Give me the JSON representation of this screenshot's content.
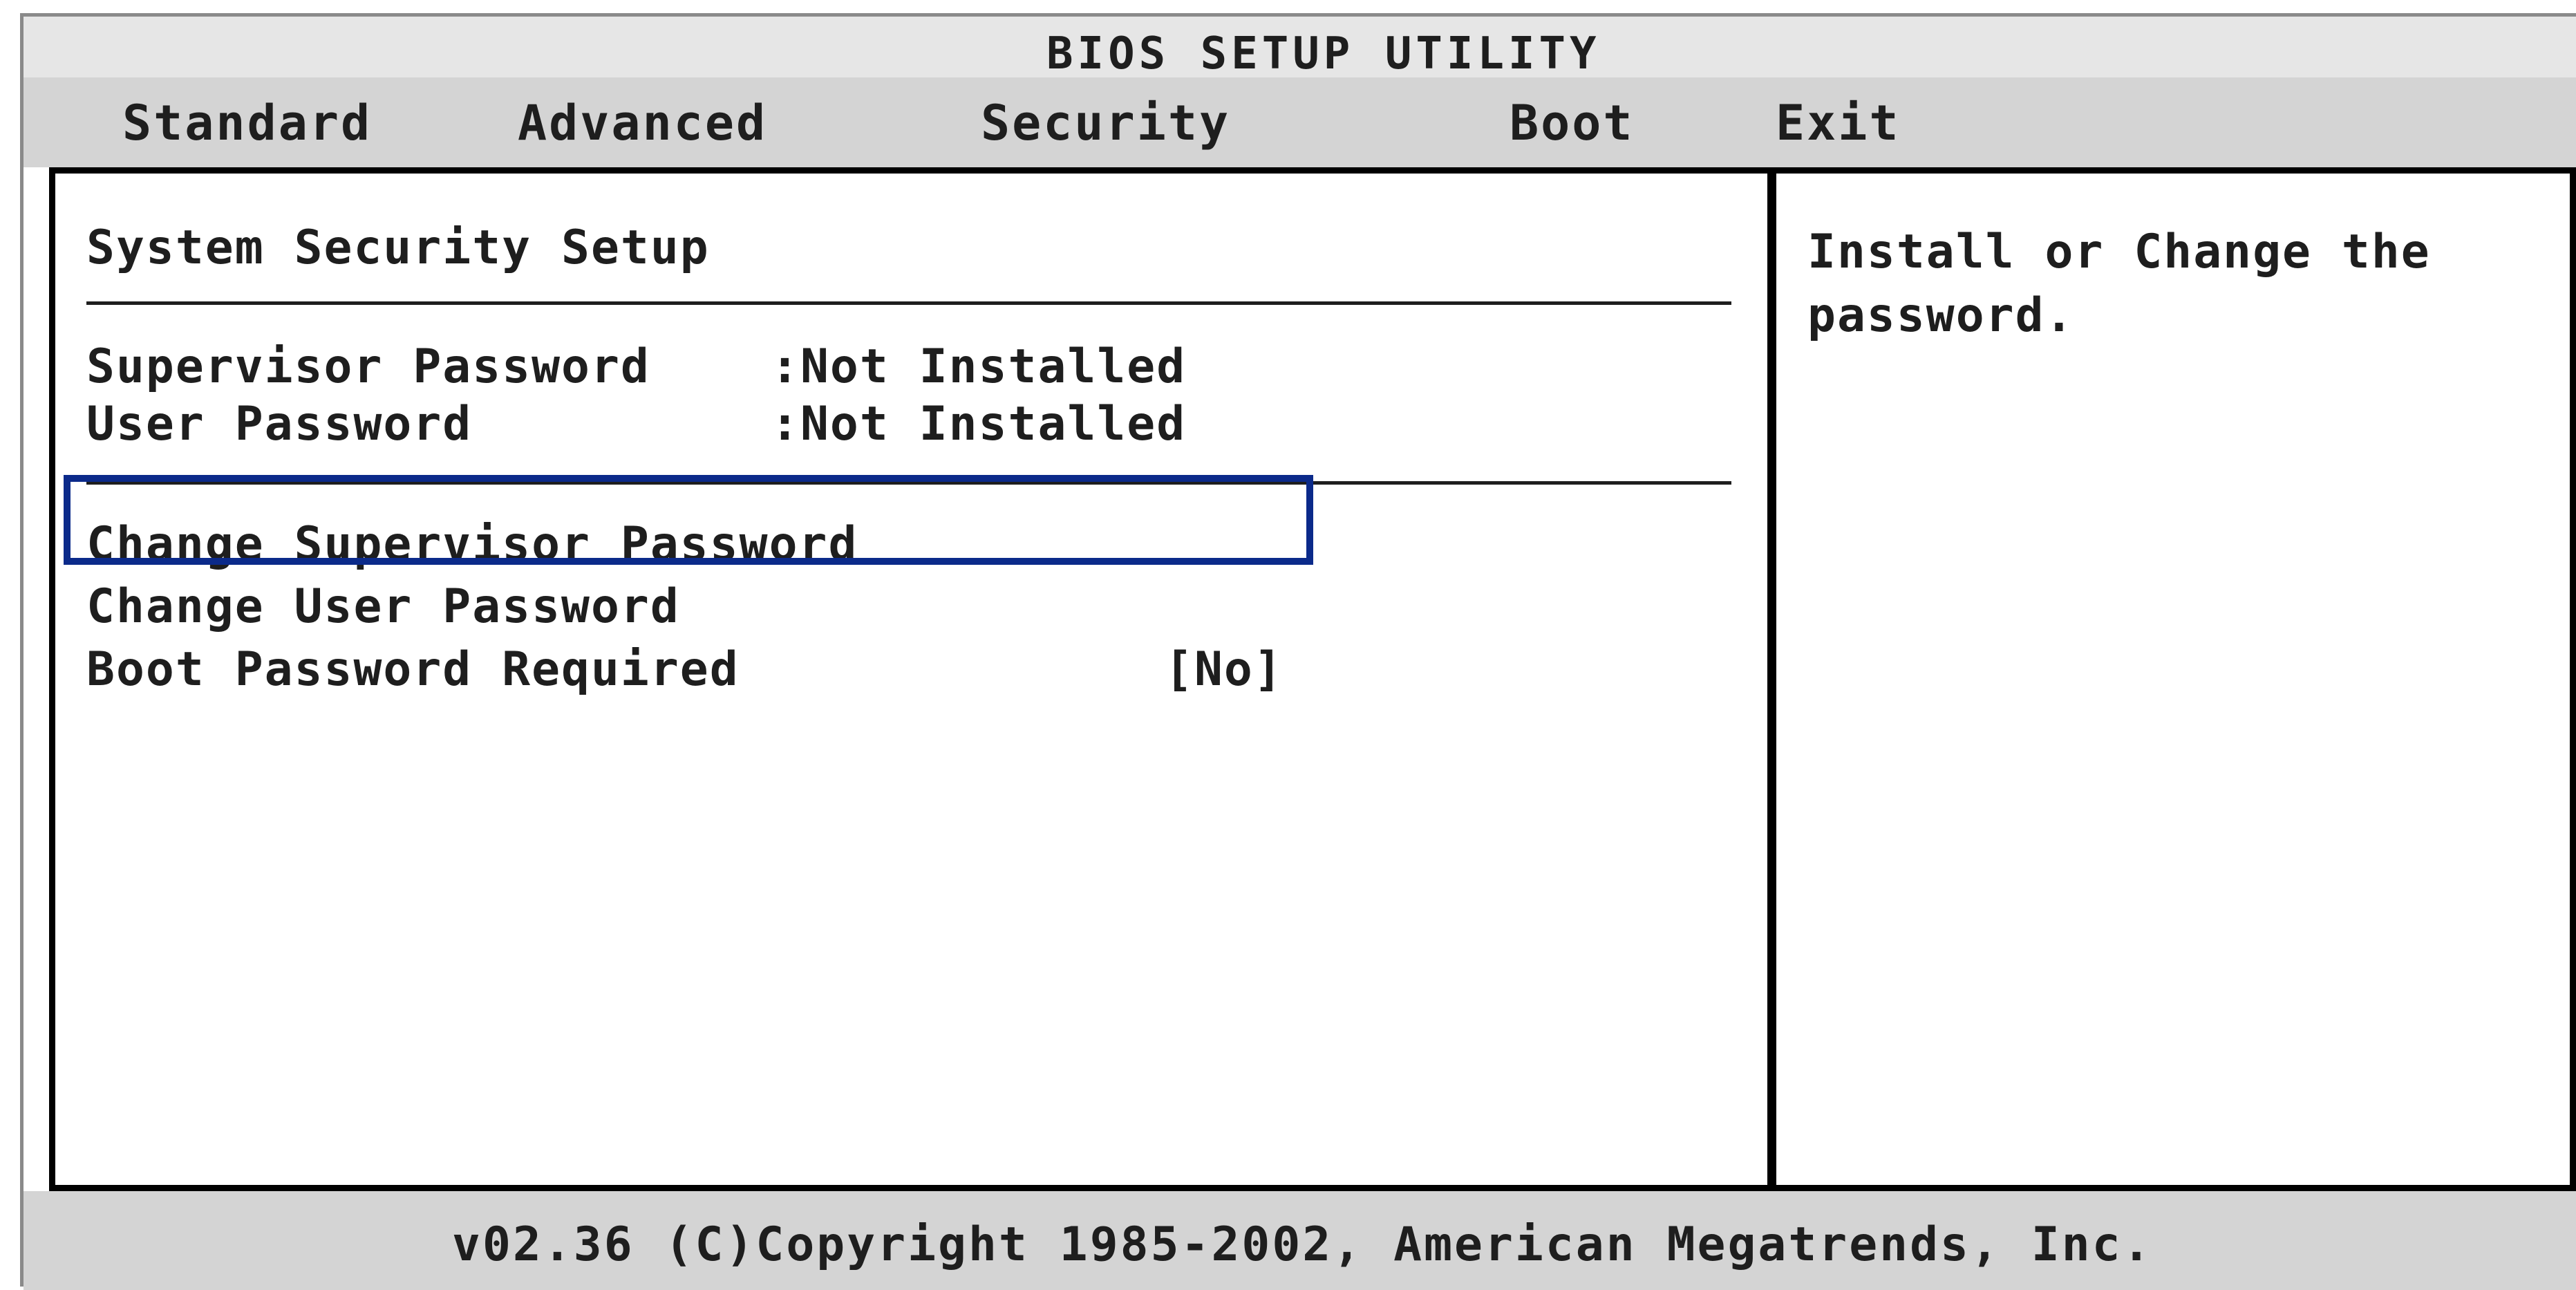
{
  "title": "BIOS SETUP UTILITY",
  "menu": {
    "items": [
      {
        "label": "Standard"
      },
      {
        "label": "Advanced"
      },
      {
        "label": "Security"
      },
      {
        "label": "Boot"
      },
      {
        "label": "Exit"
      }
    ]
  },
  "main": {
    "heading": "System Security Setup",
    "status_rows": [
      {
        "label": "Supervisor Password",
        "value": ":Not Installed"
      },
      {
        "label": "User Password",
        "value": ":Not Installed"
      }
    ],
    "actions": [
      {
        "label": "Change Supervisor Password"
      },
      {
        "label": "Change User Password"
      }
    ],
    "option": {
      "label": "Boot Password Required",
      "value": "[No]"
    }
  },
  "help": {
    "text": "Install or Change the password."
  },
  "footer": {
    "text": "v02.36 (C)Copyright 1985-2002, American Megatrends, Inc."
  },
  "colors": {
    "highlight_border": "#0b2a8a",
    "title_bar": "#e6e6e6",
    "menu_bar": "#d4d4d4",
    "text": "#1e1e1e"
  }
}
